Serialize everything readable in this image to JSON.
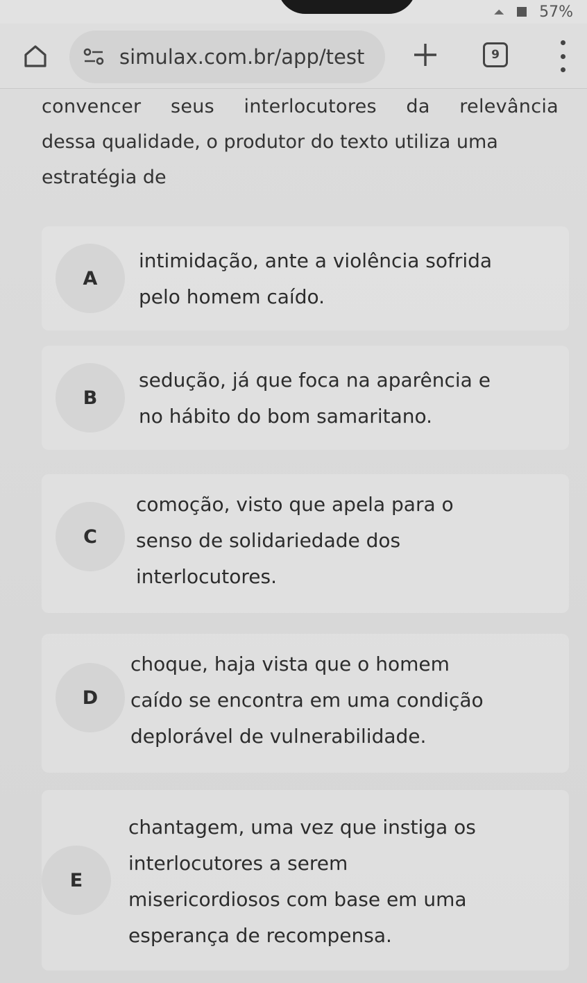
{
  "status": {
    "battery": "57%"
  },
  "browser": {
    "url": "simulax.com.br/app/test",
    "tab_count": "9"
  },
  "question": {
    "lines": [
      "convencer seus interlocutores da relevância",
      "dessa qualidade, o produtor do texto utiliza uma",
      "estratégia de"
    ]
  },
  "options": [
    {
      "letter": "A",
      "lines": [
        "intimidação, ante a violência sofrida",
        "pelo homem caído."
      ]
    },
    {
      "letter": "B",
      "lines": [
        "sedução, já que foca na aparência e",
        "no hábito do bom samaritano."
      ]
    },
    {
      "letter": "C",
      "lines": [
        "comoção, visto que apela para o",
        "senso de solidariedade dos",
        "interlocutores."
      ]
    },
    {
      "letter": "D",
      "lines": [
        "choque, haja vista que o homem",
        "caído se encontra em uma condição",
        "deplorável de vulnerabilidade."
      ]
    },
    {
      "letter": "E",
      "lines": [
        "chantagem, uma vez que instiga os",
        "interlocutores a serem",
        "misericordiosos com base em uma",
        "esperança de recompensa."
      ]
    }
  ],
  "icons": {
    "home": "home-icon",
    "site_info": "site-info-icon",
    "new_tab": "plus-icon",
    "tabs": "tab-switcher-icon",
    "menu": "more-vert-icon"
  }
}
